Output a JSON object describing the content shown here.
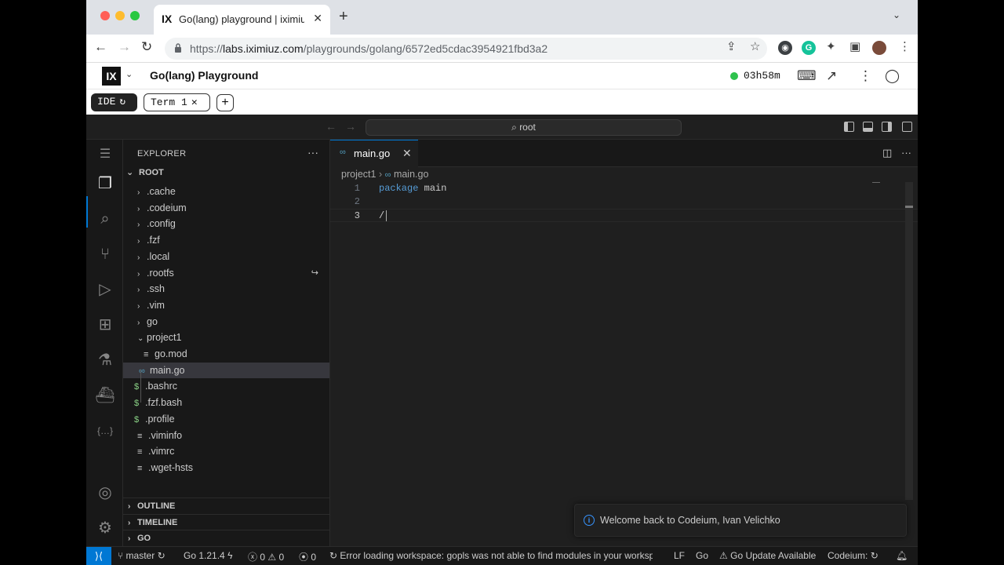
{
  "browser": {
    "tab_favicon": "IX",
    "tab_title": "Go(lang) playground | iximiuz",
    "url_prefix": "https://",
    "url_host": "labs.iximiuz.com",
    "url_path": "/playgrounds/golang/6572ed5cdac3954921fbd3a2"
  },
  "app": {
    "logo": "IX",
    "title": "Go(lang) Playground",
    "timer": "03h58m",
    "tabs": {
      "ide": "IDE",
      "term": "Term 1"
    }
  },
  "vscode": {
    "command_center": "root",
    "explorer_title": "EXPLORER",
    "root_label": "ROOT",
    "tree": [
      {
        "label": ".cache",
        "type": "folder"
      },
      {
        "label": ".codeium",
        "type": "folder"
      },
      {
        "label": ".config",
        "type": "folder"
      },
      {
        "label": ".fzf",
        "type": "folder"
      },
      {
        "label": ".local",
        "type": "folder"
      },
      {
        "label": ".rootfs",
        "type": "folder"
      },
      {
        "label": ".ssh",
        "type": "folder"
      },
      {
        "label": ".vim",
        "type": "folder"
      },
      {
        "label": "go",
        "type": "folder"
      },
      {
        "label": "project1",
        "type": "folder-open"
      },
      {
        "label": "go.mod",
        "type": "file"
      },
      {
        "label": "main.go",
        "type": "go"
      },
      {
        "label": ".bashrc",
        "type": "shell"
      },
      {
        "label": ".fzf.bash",
        "type": "shell"
      },
      {
        "label": ".profile",
        "type": "shell"
      },
      {
        "label": ".viminfo",
        "type": "file"
      },
      {
        "label": ".vimrc",
        "type": "file"
      },
      {
        "label": ".wget-hsts",
        "type": "file"
      }
    ],
    "sections": {
      "outline": "OUTLINE",
      "timeline": "TIMELINE",
      "go": "GO"
    },
    "editor": {
      "tab_label": "main.go",
      "breadcrumb_folder": "project1",
      "breadcrumb_file": "main.go",
      "lines": [
        {
          "num": "1",
          "keyword": "package",
          "rest": " main"
        },
        {
          "num": "2",
          "keyword": "",
          "rest": ""
        },
        {
          "num": "3",
          "keyword": "",
          "rest": "/"
        }
      ]
    },
    "toast": "Welcome back to Codeium, Ivan Velichko",
    "status": {
      "branch": "master",
      "go_version": "Go 1.21.4",
      "errors": "0",
      "warnings": "0",
      "ports": "0",
      "message": "Error loading workspace: gopls was not able to find modules in your worksp",
      "eol": "LF",
      "language": "Go",
      "update": "Go Update Available",
      "codeium": "Codeium:"
    }
  },
  "colors": {
    "accent": "#0078d4",
    "timer_dot": "#2ec24d",
    "keyword": "#569cd6"
  },
  "icons": [
    "back-icon",
    "forward-icon",
    "reload-icon",
    "lock-icon",
    "share-icon",
    "star-icon",
    "extensions-icon",
    "menu-icon",
    "files-icon",
    "search-icon",
    "source-control-icon",
    "run-debug-icon",
    "extensions-icon",
    "testing-icon",
    "docker-icon",
    "json-icon",
    "account-icon",
    "settings-icon",
    "bell-icon"
  ]
}
